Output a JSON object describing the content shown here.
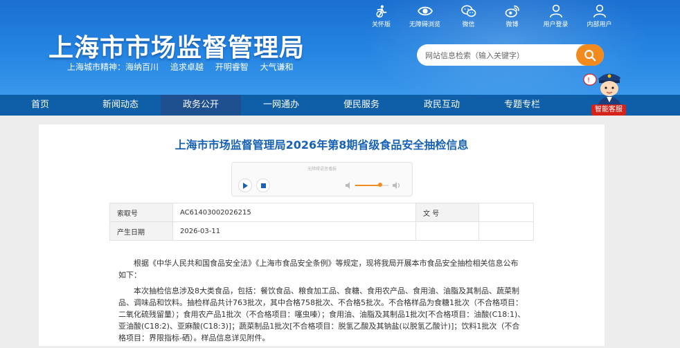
{
  "header": {
    "site_title": "上海市市场监督管理局",
    "motto": [
      "上海城市精神：海纳百川",
      "追求卓越",
      "开明睿智",
      "大气谦和"
    ],
    "toolbar": [
      {
        "label": "关怀版",
        "icon": "care-version-icon"
      },
      {
        "label": "无障碍浏览",
        "icon": "eye-icon"
      },
      {
        "label": "微信",
        "icon": "wechat-icon"
      },
      {
        "label": "微博",
        "icon": "weibo-icon"
      },
      {
        "label": "用户登录",
        "icon": "user-icon"
      },
      {
        "label": "内部用户",
        "icon": "user-icon"
      }
    ],
    "search_placeholder": "网站信息检索（输入关键字）"
  },
  "nav": {
    "items": [
      "首页",
      "新闻动态",
      "政务公开",
      "一网通办",
      "便民服务",
      "政民互动",
      "专题专栏"
    ],
    "active_index": 2
  },
  "customer_service": {
    "label": "智能客服"
  },
  "article": {
    "title": "上海市市场监督管理局2026年第8期省级食品安全抽检信息",
    "player_label": "无障碍语音播报",
    "volume_level": 0.75,
    "meta": {
      "index_label": "索取号",
      "index_value": "AC61403002026215",
      "doc_label": "文   号",
      "doc_value": "",
      "date_label": "产生日期",
      "date_value": "2026-03-11"
    },
    "paragraphs": [
      "根据《中华人民共和国食品安全法》《上海市食品安全条例》等规定，现将我局开展本市食品安全抽检相关信息公布如下：",
      "本次抽检信息涉及8大类食品，包括：餐饮食品、粮食加工品、食糖、食用农产品、食用油、油脂及其制品、蔬菜制品、调味品和饮料。抽检样品共计763批次，其中合格758批次、不合格5批次。不合格样品为食糖1批次（不合格项目：二氧化硫残留量）；食用农产品1批次（不合格项目：噻虫嗪）；食用油、油脂及其制品1批次[不合格项目：油酸(C18:1)、亚油酸(C18:2)、亚麻酸(C18:3)]；蔬菜制品1批次[不合格项目：脱氢乙酸及其钠盐(以脱氢乙酸计)]；饮料1批次（不合格项目：界限指标-硒）。样品信息详见附件。"
    ]
  },
  "colors": {
    "header_blue": "#1b6fd0",
    "nav_blue": "#0f5fa8",
    "nav_active": "#1e4f8f",
    "title_blue": "#1762b5",
    "accent_orange": "#f28b1e",
    "service_red": "#d3231b"
  }
}
